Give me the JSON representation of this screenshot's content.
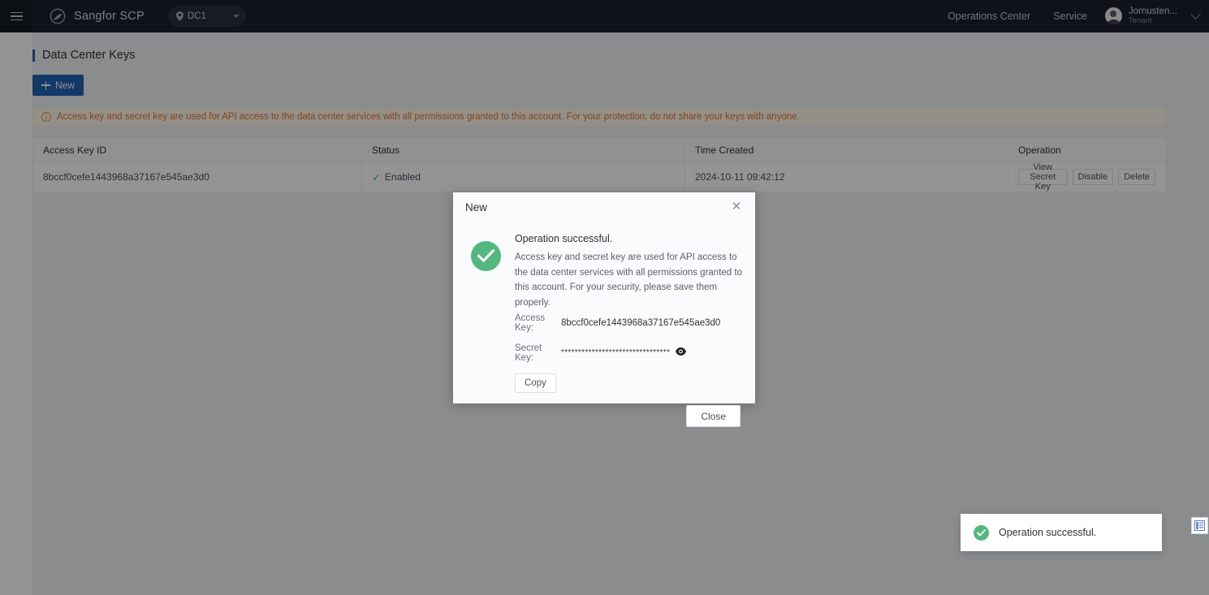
{
  "topbar": {
    "menu_icon": "hamburger-icon",
    "brand": "Sangfor SCP",
    "brand_logo_icon": "sangfor-logo-icon",
    "datacenter": {
      "icon": "location-pin-icon",
      "label": "DC1",
      "caret_icon": "chevron-down-icon"
    },
    "links": [
      {
        "label": "Operations Center"
      },
      {
        "label": "Service"
      }
    ],
    "user": {
      "avatar_icon": "user-avatar-icon",
      "name": "Jornusten...",
      "role": "Tenant",
      "caret_icon": "chevron-down-icon"
    }
  },
  "page": {
    "title": "Data Center Keys",
    "new_button": "New",
    "new_button_icon": "plus-icon",
    "banner": {
      "icon": "info-circle-icon",
      "text": "Access key and secret key are used for API access to the data center services with all permissions granted to this account. For your protection, do not share your keys with anyone."
    }
  },
  "table": {
    "columns": [
      "Access Key ID",
      "Status",
      "Time Created",
      "Operation"
    ],
    "rows": [
      {
        "access_key_id": "8bccf0cefe1443968a37167e545ae3d0",
        "status": "Enabled",
        "status_icon": "check-icon",
        "time_created": "2024-10-11 09:42:12",
        "operations": [
          "View Secret Key",
          "Disable",
          "Delete"
        ]
      }
    ]
  },
  "modal": {
    "title": "New",
    "close_icon": "close-icon",
    "success_icon": "check-circle-icon",
    "heading": "Operation successful.",
    "description": "Access key and secret key are used for API access to the data center services with all permissions granted to this account. For your security, please save them properly.",
    "access_key_label": "Access Key:",
    "access_key_value": "8bccf0cefe1443968a37167e545ae3d0",
    "secret_key_label": "Secret Key:",
    "secret_key_masked": "********************************",
    "secret_key_toggle_icon": "eye-icon",
    "copy_button": "Copy",
    "close_button": "Close"
  },
  "toast": {
    "icon": "check-circle-icon",
    "message": "Operation successful."
  },
  "side_tab": {
    "icon": "panel-toggle-icon"
  },
  "colors": {
    "topbar_bg": "#1b222c",
    "primary": "#1f63b3",
    "success": "#53b87f",
    "warning_text": "#e6762c",
    "warning_bg": "#fdf6ec"
  }
}
